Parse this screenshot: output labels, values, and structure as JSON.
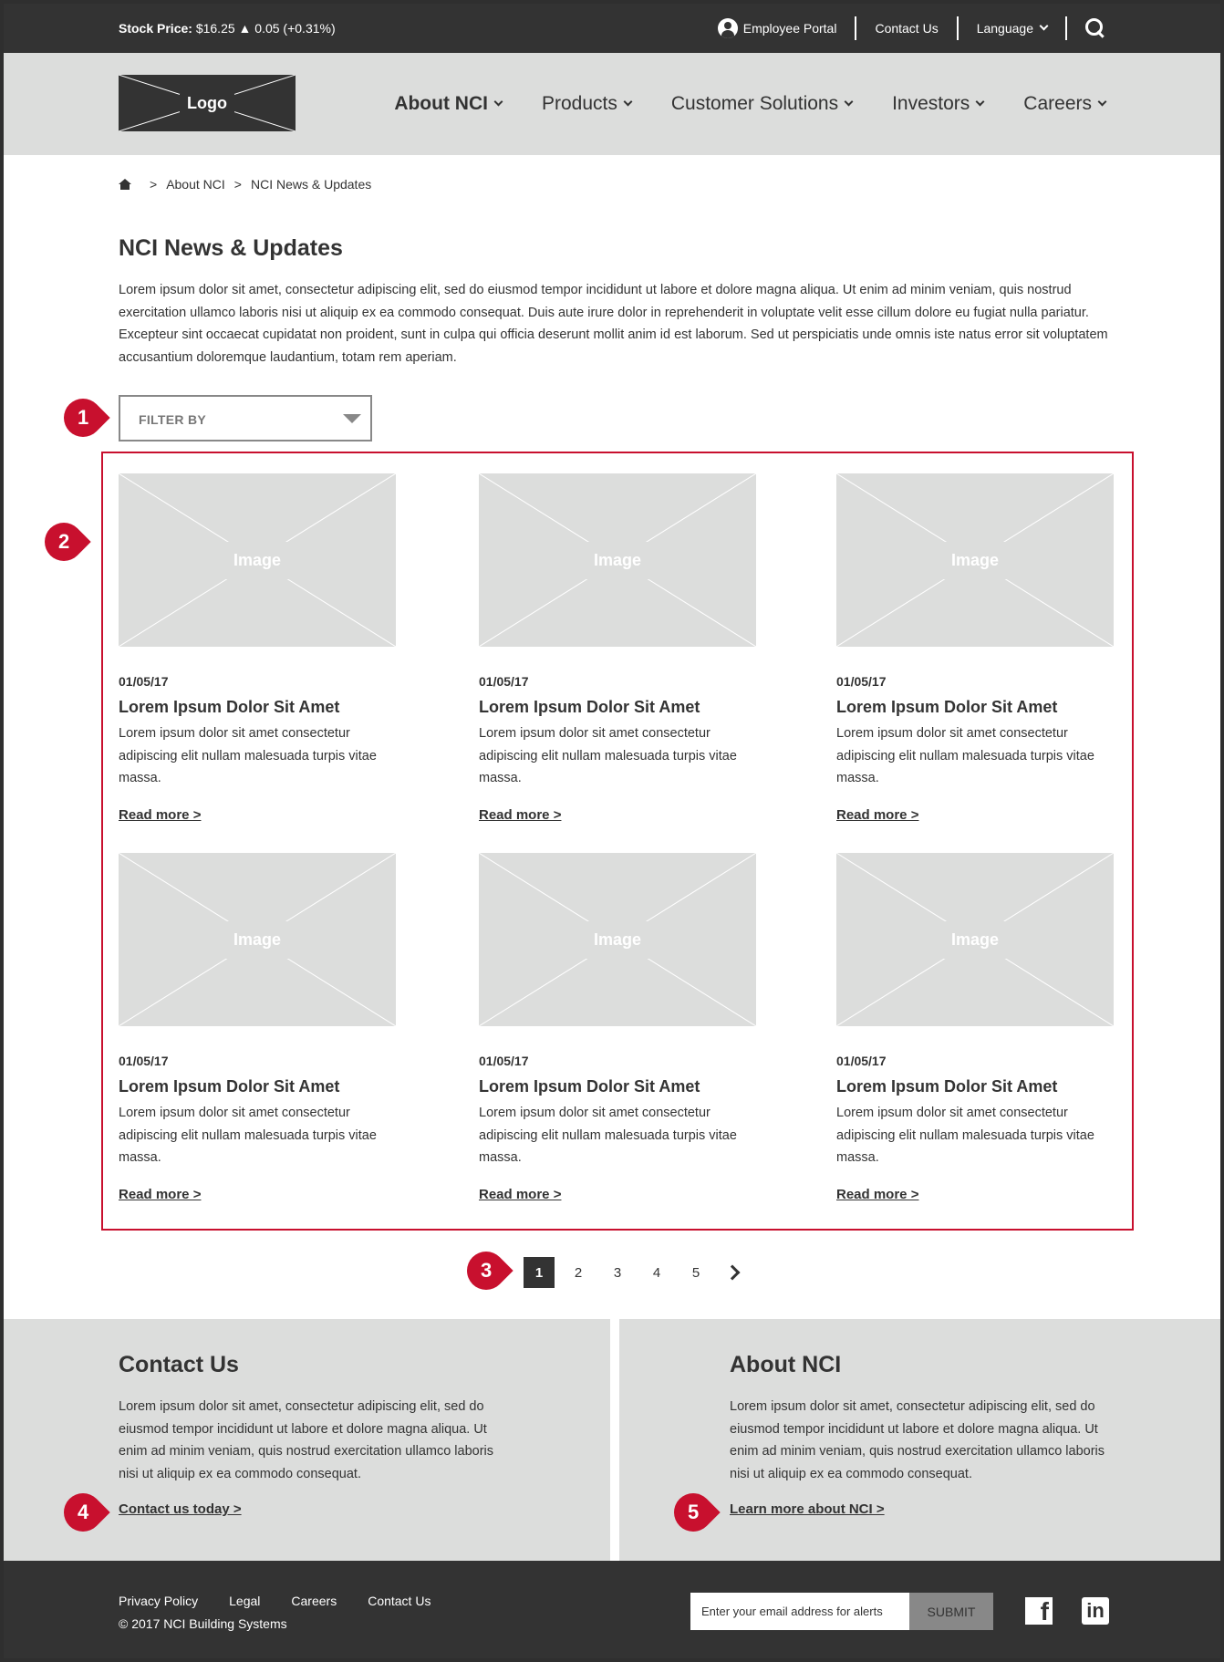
{
  "topbar": {
    "stock_label": "Stock Price:",
    "stock_value": "$16.25",
    "stock_change": "▲ 0.05 (+0.31%)",
    "employee_portal": "Employee Portal",
    "contact_us": "Contact Us",
    "language": "Language"
  },
  "header": {
    "logo": "Logo",
    "nav": [
      {
        "label": "About NCI"
      },
      {
        "label": "Products"
      },
      {
        "label": "Customer Solutions"
      },
      {
        "label": "Investors"
      },
      {
        "label": "Careers"
      }
    ]
  },
  "breadcrumb": [
    "About NCI",
    "NCI News & Updates"
  ],
  "breadcrumb_sep": ">",
  "page": {
    "title": "NCI News & Updates",
    "intro": "Lorem ipsum dolor sit amet, consectetur adipiscing elit, sed do eiusmod tempor incididunt ut labore et dolore magna aliqua. Ut enim ad minim veniam, quis nostrud exercitation ullamco laboris nisi ut aliquip ex ea commodo consequat. Duis aute irure dolor in reprehenderit in voluptate velit esse cillum dolore eu fugiat nulla pariatur. Excepteur sint occaecat cupidatat non proident, sunt in culpa qui officia deserunt mollit anim id est laborum. Sed ut perspiciatis unde omnis iste natus error sit voluptatem accusantium doloremque laudantium, totam rem aperiam."
  },
  "filter": {
    "label": "FILTER BY"
  },
  "markers": [
    "1",
    "2",
    "3",
    "4",
    "5"
  ],
  "cards": [
    {
      "image": "Image",
      "date": "01/05/17",
      "title": "Lorem Ipsum Dolor Sit Amet",
      "body": "Lorem ipsum dolor sit amet consectetur adipiscing elit nullam malesuada turpis vitae massa.",
      "link": "Read more >"
    },
    {
      "image": "Image",
      "date": "01/05/17",
      "title": "Lorem Ipsum Dolor Sit Amet",
      "body": "Lorem ipsum dolor sit amet consectetur adipiscing elit nullam malesuada turpis vitae massa.",
      "link": "Read more >"
    },
    {
      "image": "Image",
      "date": "01/05/17",
      "title": "Lorem Ipsum Dolor Sit Amet",
      "body": "Lorem ipsum dolor sit amet consectetur adipiscing elit nullam malesuada turpis vitae massa.",
      "link": "Read more >"
    },
    {
      "image": "Image",
      "date": "01/05/17",
      "title": "Lorem Ipsum Dolor Sit Amet",
      "body": "Lorem ipsum dolor sit amet consectetur adipiscing elit nullam malesuada turpis vitae massa.",
      "link": "Read more >"
    },
    {
      "image": "Image",
      "date": "01/05/17",
      "title": "Lorem Ipsum Dolor Sit Amet",
      "body": "Lorem ipsum dolor sit amet consectetur adipiscing elit nullam malesuada turpis vitae massa.",
      "link": "Read more >"
    },
    {
      "image": "Image",
      "date": "01/05/17",
      "title": "Lorem Ipsum Dolor Sit Amet",
      "body": "Lorem ipsum dolor sit amet consectetur adipiscing elit nullam malesuada turpis vitae massa.",
      "link": "Read more >"
    }
  ],
  "pagination": {
    "pages": [
      "1",
      "2",
      "3",
      "4",
      "5"
    ],
    "current": "1"
  },
  "contact_panel": {
    "title": "Contact Us",
    "body": "Lorem ipsum dolor sit amet, consectetur adipiscing elit, sed do eiusmod tempor incididunt ut labore et dolore magna aliqua. Ut enim ad minim veniam, quis nostrud exercitation ullamco laboris nisi ut aliquip ex ea commodo consequat.",
    "link": "Contact us today >"
  },
  "about_panel": {
    "title": "About NCI",
    "body": "Lorem ipsum dolor sit amet, consectetur adipiscing elit, sed do eiusmod tempor incididunt ut labore et dolore magna aliqua. Ut enim ad minim veniam, quis nostrud exercitation ullamco laboris nisi ut aliquip ex ea commodo consequat.",
    "link": "Learn more about NCI >"
  },
  "footer": {
    "links": [
      "Privacy Policy",
      "Legal",
      "Careers",
      "Contact Us"
    ],
    "copyright": "© 2017 NCI Building Systems",
    "email_placeholder": "Enter your email address for alerts",
    "submit": "SUBMIT",
    "facebook": "f",
    "linkedin": "in"
  },
  "colors": {
    "accent": "#c8102e",
    "dark": "#333333",
    "panel": "#dcdddc"
  }
}
